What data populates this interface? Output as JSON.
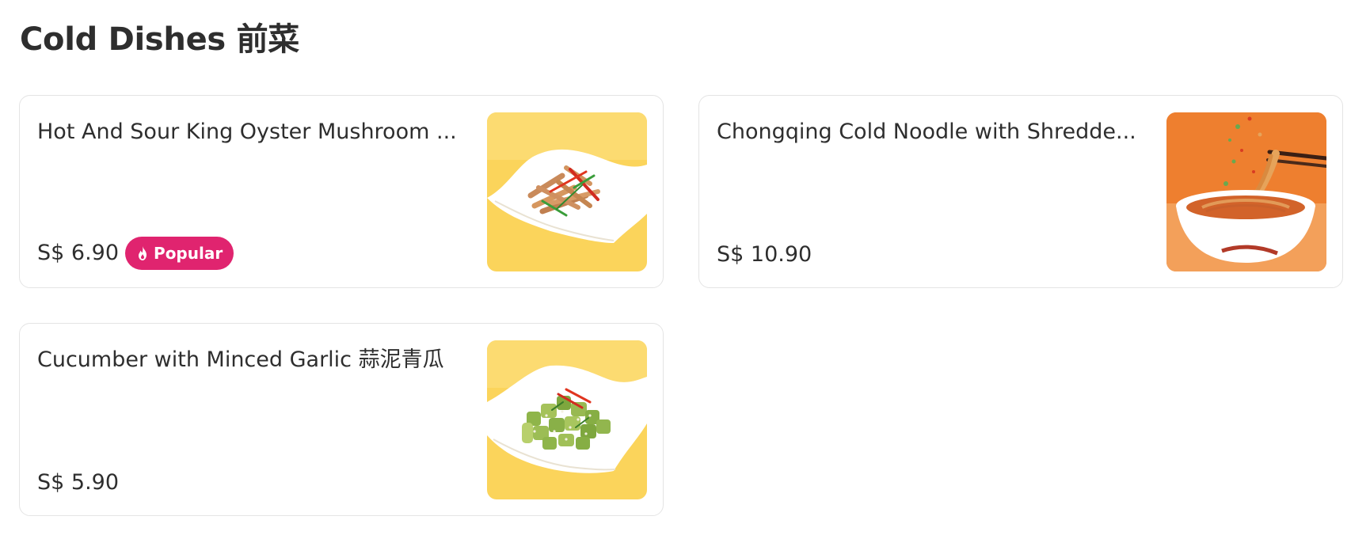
{
  "section": {
    "title": "Cold Dishes 前菜"
  },
  "colors": {
    "popular_badge": "#e0246f",
    "text": "#2e2e2e",
    "card_border": "#e4e4e4"
  },
  "items": [
    {
      "name": "Hot And Sour King Oyster Mushroom ...",
      "price": "S$ 6.90",
      "badge": {
        "label": "Popular",
        "icon": "flame-icon"
      },
      "image": "hot-sour-king-oyster-mushroom-photo"
    },
    {
      "name": "Chongqing Cold Noodle with Shredde...",
      "price": "S$ 10.90",
      "image": "chongqing-cold-noodle-photo"
    },
    {
      "name": "Cucumber with Minced Garlic 蒜泥青瓜",
      "price": "S$ 5.90",
      "image": "cucumber-minced-garlic-photo"
    }
  ]
}
